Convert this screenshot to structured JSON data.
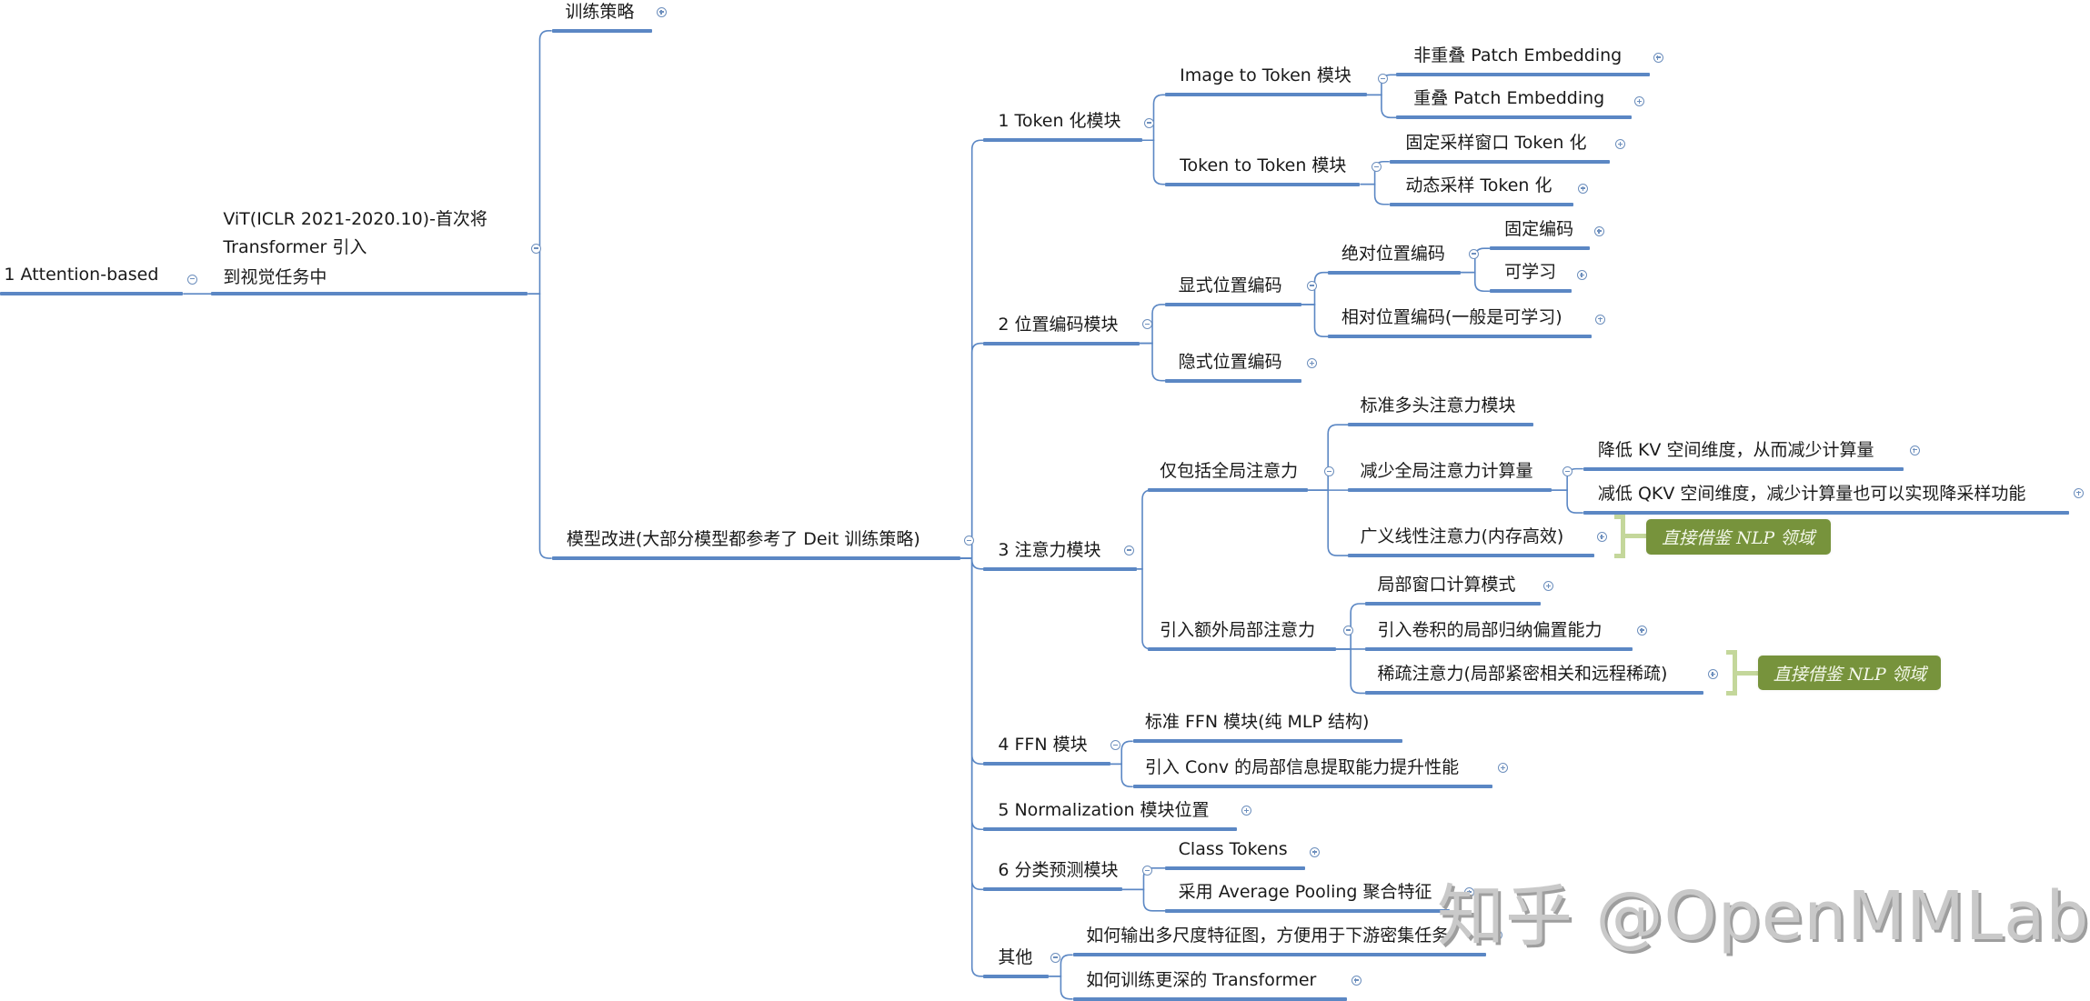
{
  "colors": {
    "branch_line": "#5b87c4",
    "connector": "#5b87c4",
    "callout_bg": "#77933c",
    "callout_bracket": "#c4d79b",
    "watermark": "#c9c9c9"
  },
  "watermark": "知乎 @OpenMMLab",
  "root": {
    "label": "1 Attention-based",
    "toggle": "collapse-icon"
  },
  "vit": {
    "label_lines": [
      "ViT(ICLR 2021-2020.10)-首次将",
      "Transformer 引入",
      "到视觉任务中"
    ],
    "toggle": "collapse-icon"
  },
  "training": {
    "label": "训练策略",
    "toggle": "expand-icon"
  },
  "improve": {
    "label": "模型改进(大部分模型都参考了 Deit 训练策略)",
    "toggle": "collapse-icon"
  },
  "modules": {
    "token": {
      "label": "1 Token 化模块",
      "children": {
        "img2tok": {
          "label": "Image to Token 模块",
          "children": [
            "非重叠 Patch Embedding",
            "重叠 Patch Embedding"
          ]
        },
        "tok2tok": {
          "label": "Token to Token 模块",
          "children": [
            "固定采样窗口 Token 化",
            "动态采样 Token 化"
          ]
        }
      }
    },
    "pos": {
      "label": "2 位置编码模块",
      "children": {
        "explicit": {
          "label": "显式位置编码",
          "abs": {
            "label": "绝对位置编码",
            "children": [
              "固定编码",
              "可学习"
            ]
          },
          "rel": {
            "label": "相对位置编码(一般是可学习)"
          }
        },
        "implicit": {
          "label": "隐式位置编码"
        }
      }
    },
    "attn": {
      "label": "3 注意力模块",
      "children": {
        "global": {
          "label": "仅包括全局注意力",
          "std": {
            "label": "标准多头注意力模块"
          },
          "reduce": {
            "label": "减少全局注意力计算量",
            "children": [
              "降低 KV 空间维度，从而减少计算量",
              "减低 QKV 空间维度，减少计算量也可以实现降采样功能"
            ]
          },
          "linear": {
            "label": "广义线性注意力(内存高效)",
            "callout": "直接借鉴 NLP 领域"
          }
        },
        "local": {
          "label": "引入额外局部注意力",
          "children": [
            "局部窗口计算模式",
            "引入卷积的局部归纳偏置能力"
          ],
          "sparse": {
            "label": "稀疏注意力(局部紧密相关和远程稀疏)",
            "callout": "直接借鉴 NLP 领域"
          }
        }
      }
    },
    "ffn": {
      "label": "4 FFN 模块",
      "children": [
        "标准  FFN 模块(纯 MLP 结构)",
        "引入 Conv 的局部信息提取能力提升性能"
      ]
    },
    "norm": {
      "label": "5 Normalization 模块位置"
    },
    "cls": {
      "label": "6 分类预测模块",
      "children": [
        "Class Tokens",
        "采用 Average Pooling 聚合特征"
      ]
    },
    "other": {
      "label": "其他",
      "children": [
        "如何输出多尺度特征图，方便用于下游密集任务",
        "如何训练更深的 Transformer"
      ]
    }
  }
}
